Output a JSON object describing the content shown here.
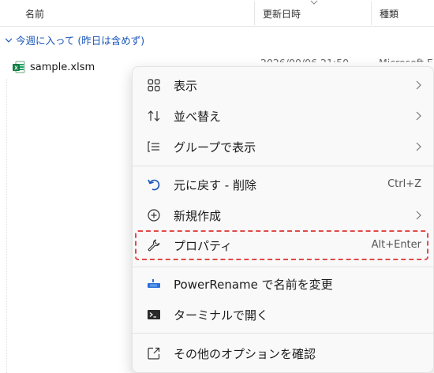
{
  "header": {
    "col_name": "名前",
    "col_modified": "更新日時",
    "col_type": "種類"
  },
  "group": {
    "label": "今週に入って (昨日は含めず)"
  },
  "file": {
    "name": "sample.xlsm",
    "modified_partial": "2026/00/06 21:50",
    "type_partial": "Microsoft E"
  },
  "menu": {
    "items": [
      {
        "label": "表示",
        "icon": "grid-icon",
        "has_submenu": true
      },
      {
        "label": "並べ替え",
        "icon": "sort-arrows-icon",
        "has_submenu": true
      },
      {
        "label": "グループで表示",
        "icon": "group-list-icon",
        "has_submenu": true
      },
      {
        "label": "元に戻す - 削除",
        "icon": "undo-icon",
        "shortcut": "Ctrl+Z"
      },
      {
        "label": "新規作成",
        "icon": "plus-circle-icon",
        "has_submenu": true
      },
      {
        "label": "プロパティ",
        "icon": "wrench-icon",
        "shortcut": "Alt+Enter",
        "highlighted": true
      },
      {
        "label": "PowerRename で名前を変更",
        "icon": "powerrename-icon"
      },
      {
        "label": "ターミナルで開く",
        "icon": "terminal-icon"
      },
      {
        "label": "その他のオプションを確認",
        "icon": "more-options-icon"
      }
    ]
  },
  "colors": {
    "accent_blue": "#1a56b8",
    "highlight_red": "#e04b48",
    "menu_bg": "#f9f9f9"
  }
}
